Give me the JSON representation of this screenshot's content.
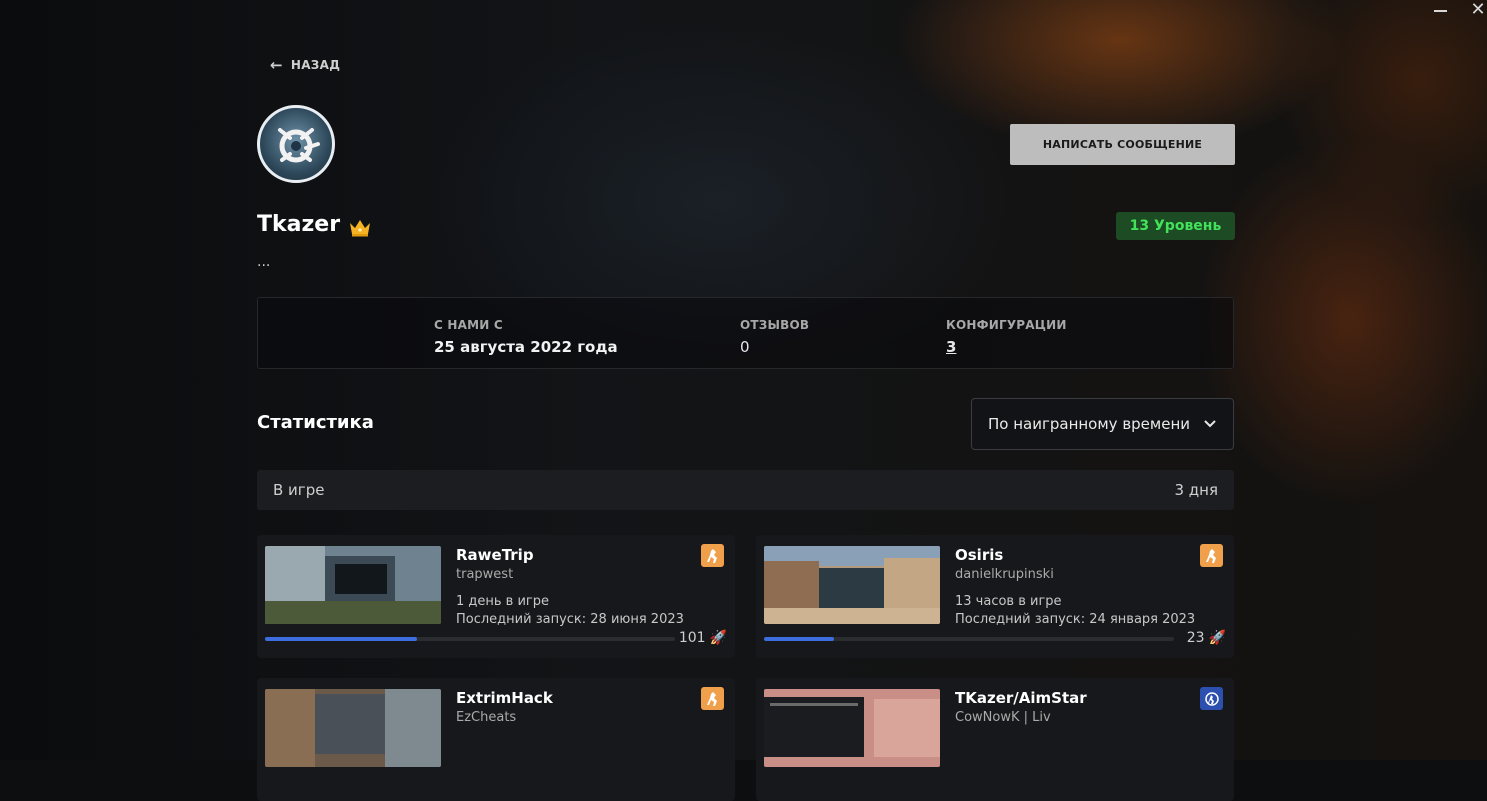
{
  "window": {
    "minimize_icon": "minimize-icon",
    "close_icon": "close-icon",
    "close_glyph": "✕"
  },
  "back": {
    "label": "НАЗАД",
    "icon": "arrow-left-icon"
  },
  "profile": {
    "username": "Tkazer",
    "bio": "...",
    "level": "13 Уровень",
    "message_button": "НАПИСАТЬ СООБЩЕНИЕ",
    "badge_icon": "crown-icon"
  },
  "info": {
    "member_since_label": "С НАМИ С",
    "member_since_value": "25 августа 2022 года",
    "reviews_label": "ОТЗЫВОВ",
    "reviews_value": "0",
    "configs_label": "КОНФИГУРАЦИИ",
    "configs_value": "3"
  },
  "stats": {
    "title": "Статистика",
    "sort_selected": "По наигранному времени",
    "in_game_label": "В игре",
    "in_game_value": "3 дня"
  },
  "cards": [
    {
      "name": "RaweTrip",
      "author": "trapwest",
      "playtime": "1 день в игре",
      "last_run": "Последний запуск: 28 июня 2023",
      "launches": "101",
      "progress": 0.37,
      "game_icon": "csgo-icon",
      "icon_color": "#f0a04a"
    },
    {
      "name": "Osiris",
      "author": "danielkrupinski",
      "playtime": "13 часов в игре",
      "last_run": "Последний запуск: 24 января 2023",
      "launches": "23",
      "progress": 0.17,
      "game_icon": "csgo-icon",
      "icon_color": "#f0a04a"
    },
    {
      "name": "ExtrimHack",
      "author": "EzCheats",
      "playtime": "",
      "last_run": "",
      "launches": "",
      "progress": 0,
      "game_icon": "csgo-icon",
      "icon_color": "#f0a04a"
    },
    {
      "name": "TKazer/AimStar",
      "author": "CowNowK | Liv",
      "playtime": "",
      "last_run": "",
      "launches": "",
      "progress": 0,
      "game_icon": "cs2-icon",
      "icon_color": "#2d4fb0"
    }
  ]
}
